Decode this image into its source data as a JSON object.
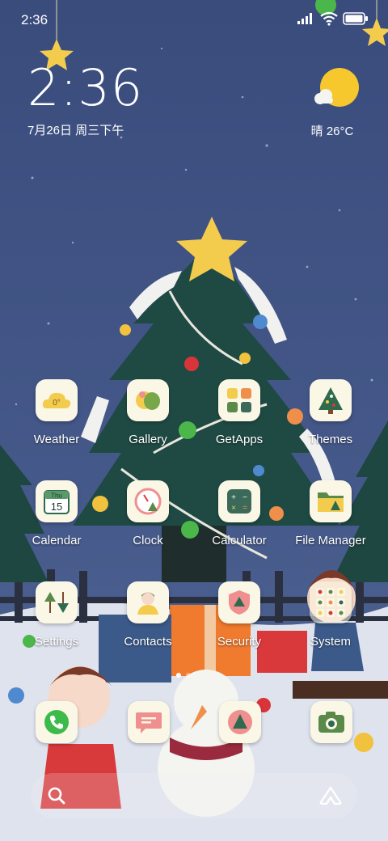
{
  "status_bar": {
    "time": "2:36"
  },
  "clock_widget": {
    "time": "2:36",
    "date": "7月26日 周三下午"
  },
  "weather_widget": {
    "icon": "sun-cloud-icon",
    "text": "晴 26°C"
  },
  "apps": [
    {
      "label": "Weather",
      "icon": "weather-app-icon",
      "icon_text": "0°"
    },
    {
      "label": "Gallery",
      "icon": "gallery-app-icon"
    },
    {
      "label": "GetApps",
      "icon": "getapps-app-icon"
    },
    {
      "label": "Themes",
      "icon": "themes-app-icon"
    },
    {
      "label": "Calendar",
      "icon": "calendar-app-icon",
      "icon_text_day": "Thu",
      "icon_text_date": "15"
    },
    {
      "label": "Clock",
      "icon": "clock-app-icon"
    },
    {
      "label": "Calculator",
      "icon": "calculator-app-icon"
    },
    {
      "label": "File Manager",
      "icon": "file-manager-app-icon"
    },
    {
      "label": "Settings",
      "icon": "settings-app-icon"
    },
    {
      "label": "Contacts",
      "icon": "contacts-app-icon"
    },
    {
      "label": "Security",
      "icon": "security-app-icon"
    },
    {
      "label": "System",
      "icon": "system-folder-icon"
    }
  ],
  "dock": [
    {
      "icon": "phone-app-icon"
    },
    {
      "icon": "messaging-app-icon"
    },
    {
      "icon": "browser-app-icon"
    },
    {
      "icon": "camera-app-icon"
    }
  ],
  "page_indicator": {
    "current": 1,
    "total": 2
  },
  "search_bar": {
    "search_icon": "search-icon",
    "assistant_icon": "assistant-icon"
  },
  "colors": {
    "sky": "#3f5384",
    "tree": "#1f4a44",
    "icon_bg": "#fbf7e6",
    "star": "#f3cc4e",
    "sun": "#f7c82d"
  }
}
